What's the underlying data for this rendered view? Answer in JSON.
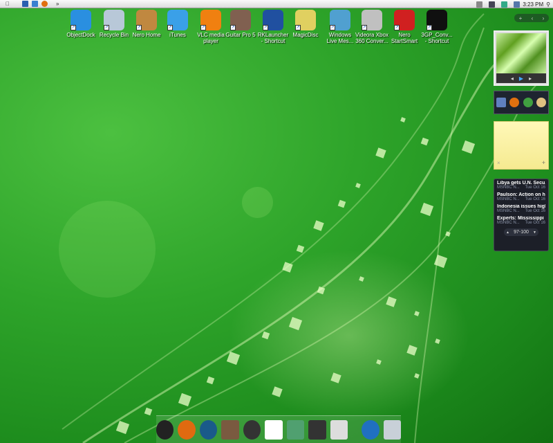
{
  "menubar": {
    "overflow": "»",
    "clock": "3:23 PM"
  },
  "desktop_icons": [
    {
      "label": "ObjectDock",
      "color": "#2a8fe0"
    },
    {
      "label": "Recycle Bin",
      "color": "#b8c8d8"
    },
    {
      "label": "Nero Home",
      "color": "#c08840"
    },
    {
      "label": "iTunes",
      "color": "#3aa0e8"
    },
    {
      "label": "VLC media player",
      "color": "#f08010"
    },
    {
      "label": "Guitar Pro 5",
      "color": "#806050"
    },
    {
      "label": "RKLauncher - Shortcut",
      "color": "#2050a0"
    },
    {
      "label": "MagicDisc",
      "color": "#e0d060"
    },
    {
      "label": "Windows Live Mes...",
      "color": "#50a0d0"
    },
    {
      "label": "Videora Xbox 360 Conver...",
      "color": "#c0c0c0"
    },
    {
      "label": "Nero StartSmart",
      "color": "#d02020"
    },
    {
      "label": "3GP_Conv... - Shortcut",
      "color": "#101010"
    }
  ],
  "gadgets": {
    "slideshow_controls": {
      "prev": "◂",
      "play": "▶",
      "next": "▸"
    },
    "sticky_note": {
      "close": "×",
      "add": "+"
    },
    "news": {
      "items": [
        {
          "title": "Libya gets U.N. Secu...",
          "source": "MSNBC N...",
          "date": "Tue Oct 16"
        },
        {
          "title": "Paulson: Action on h...",
          "source": "MSNBC N...",
          "date": "Tue Oct 16"
        },
        {
          "title": "Indonesia issues high...",
          "source": "MSNBC N...",
          "date": "Tue Oct 16"
        },
        {
          "title": "Experts: Mississippi ...",
          "source": "MSNBC N...",
          "date": "Tue Oct 16"
        }
      ],
      "pager": "97-100",
      "up": "▲",
      "down": "▼"
    },
    "sidebar_controls": {
      "add": "+",
      "prev": "‹",
      "next": "›"
    }
  },
  "dock": [
    {
      "name": "objectdock",
      "color": "#222"
    },
    {
      "name": "firefox",
      "color": "#e06a10"
    },
    {
      "name": "media-center",
      "color": "#1a5a8a"
    },
    {
      "name": "guitar-pro",
      "color": "#7a5a40"
    },
    {
      "name": "itunes",
      "color": "#333"
    },
    {
      "name": "feather",
      "color": "#fff"
    },
    {
      "name": "photo-gallery",
      "color": "#50a070"
    },
    {
      "name": "movie-maker",
      "color": "#333"
    },
    {
      "name": "tools",
      "color": "#ddd"
    },
    {
      "name": "internet",
      "color": "#2070c0"
    },
    {
      "name": "recycle-bin",
      "color": "#c8d0d8"
    }
  ]
}
